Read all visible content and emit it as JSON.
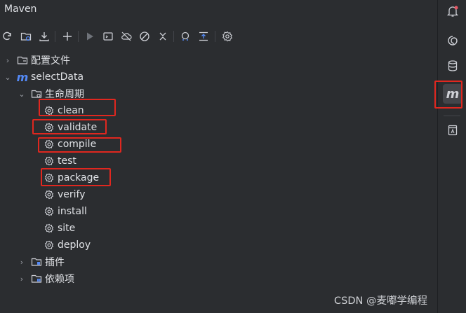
{
  "title": "Maven",
  "tree": {
    "config": "配置文件",
    "project": "selectData",
    "lifecycle": "生命周期",
    "phases": [
      "clean",
      "validate",
      "compile",
      "test",
      "package",
      "verify",
      "install",
      "site",
      "deploy"
    ],
    "plugins": "插件",
    "deps": "依赖项"
  },
  "watermark": "CSDN @麦嘟学编程",
  "colors": {
    "highlight": "#e0271f",
    "accent": "#548af7"
  }
}
